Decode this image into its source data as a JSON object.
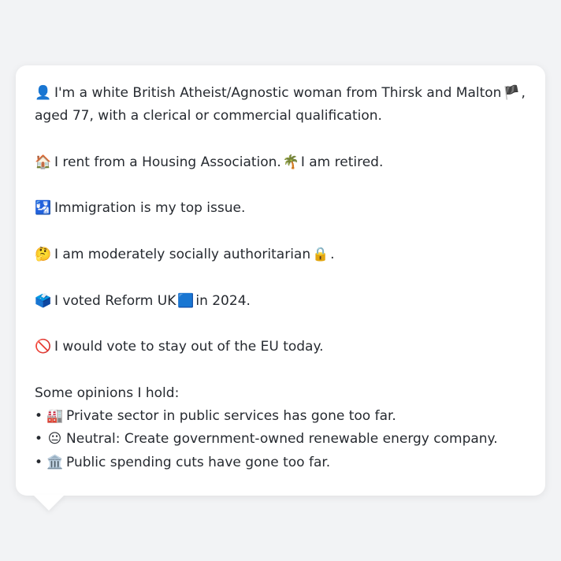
{
  "card": {
    "identity": {
      "icon": "👤",
      "text_before_flag": "I'm a white British Atheist/Agnostic woman from Thirsk and Malton",
      "flag": "🏴",
      "text_after_flag": ",",
      "line2": "aged 77, with a clerical or commercial qualification."
    },
    "housing": {
      "icon": "🏠",
      "text1": "I rent from a Housing Association.",
      "icon2": "🌴",
      "text2": "I am retired."
    },
    "issue": {
      "icon": "🛂",
      "text": "Immigration is my top issue."
    },
    "values": {
      "icon": "🤔",
      "text": "I am moderately socially authoritarian",
      "icon2": "🔒",
      "suffix": "."
    },
    "vote": {
      "icon": "🗳️",
      "text1": "I voted Reform UK",
      "party_icon": "🟦",
      "text2": "in 2024."
    },
    "eu": {
      "icon": "🚫",
      "text": "I would vote to stay out of the EU today."
    },
    "opinions": {
      "heading": "Some opinions I hold:",
      "bullet": "•",
      "items": [
        {
          "icon": "🏭",
          "text": "Private sector in public services has gone too far."
        },
        {
          "icon": "😐",
          "text": "Neutral: Create government-owned renewable energy company."
        },
        {
          "icon": "🏛️",
          "text": "Public spending cuts have gone too far."
        }
      ]
    }
  }
}
